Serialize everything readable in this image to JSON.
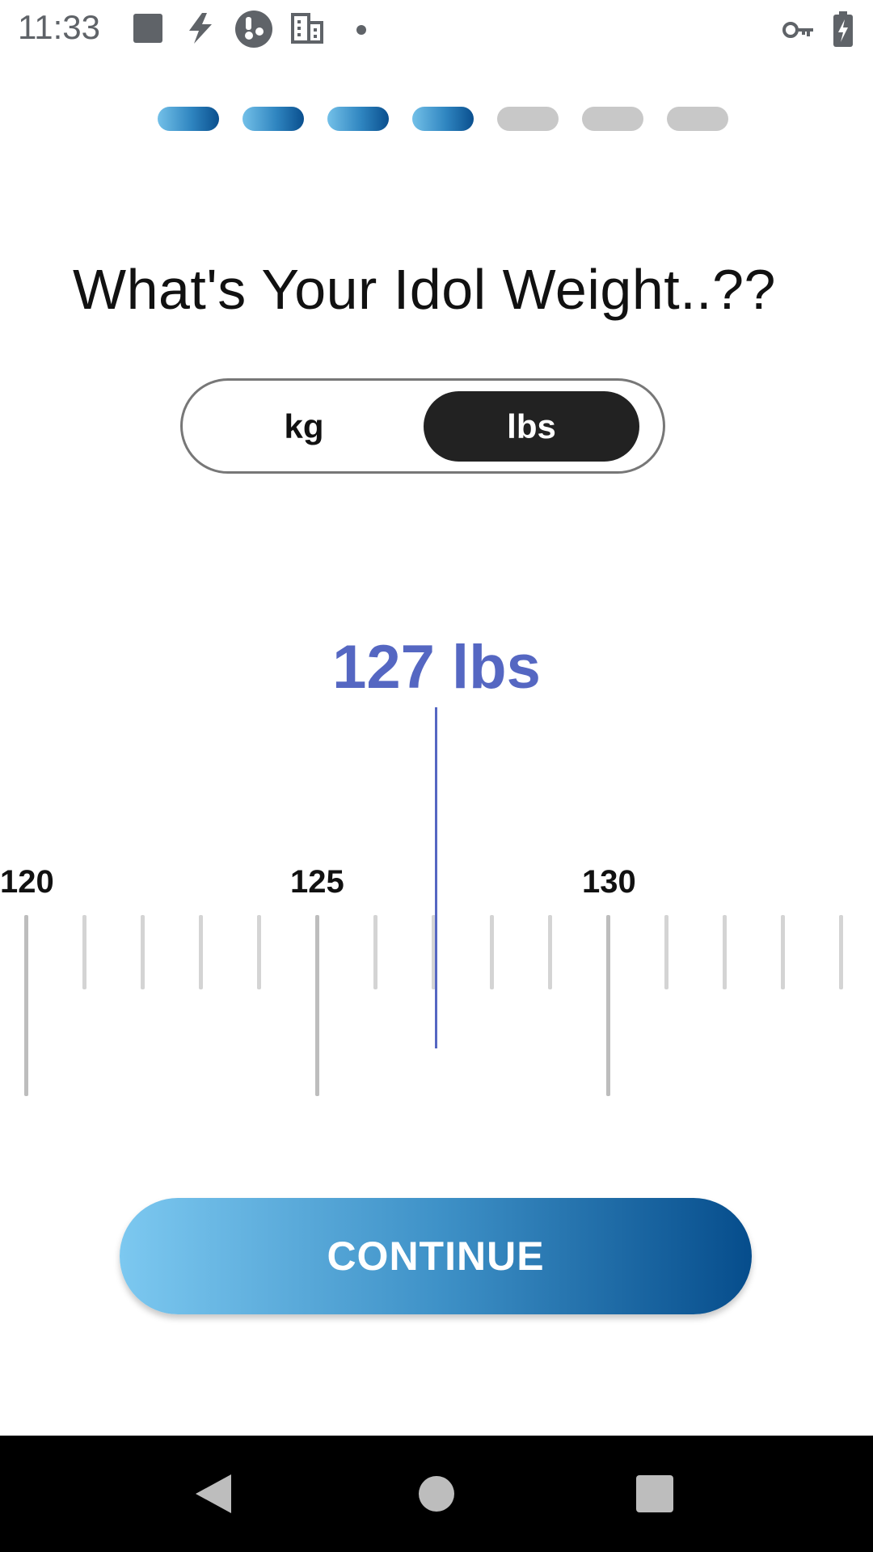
{
  "status_bar": {
    "time": "11:33",
    "left_icons": [
      "stop-square-icon",
      "flash-icon",
      "app-logo-icon",
      "building-icon",
      "dot-icon"
    ],
    "right_icons": [
      "key-icon",
      "battery-charging-icon"
    ]
  },
  "progress": {
    "total_steps": 7,
    "completed_steps": 4,
    "active_color_start": "#73c0e8",
    "active_color_end": "#0a4f8e",
    "inactive_color": "#c8c8c8"
  },
  "screen": {
    "title": "What's Your Idol Weight..??"
  },
  "unit_toggle": {
    "options": [
      "kg",
      "lbs"
    ],
    "selected": "lbs"
  },
  "weight": {
    "readout": "127 lbs",
    "value": 127,
    "unit": "lbs"
  },
  "ruler": {
    "labels": [
      "120",
      "125",
      "130"
    ],
    "range_shown": [
      120,
      134
    ],
    "step": 1,
    "major_every": 5
  },
  "continue_button": {
    "label": "CONTINUE"
  },
  "nav_bar": {
    "buttons": [
      "back-triangle-icon",
      "home-circle-icon",
      "recents-square-icon"
    ]
  },
  "colors": {
    "accent": "#5567c2",
    "toggle_selected_bg": "#222222"
  }
}
